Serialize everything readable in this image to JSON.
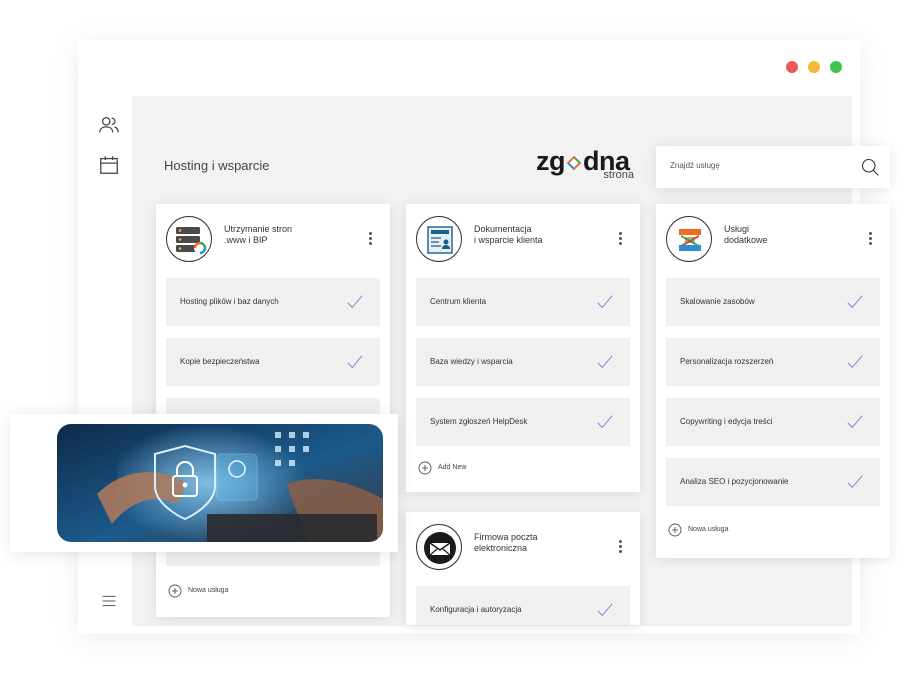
{
  "window": {
    "controls": [
      {
        "name": "close",
        "color": "#ec5b5b"
      },
      {
        "name": "minimize",
        "color": "#f2b83a"
      },
      {
        "name": "maximize",
        "color": "#3ec44c"
      }
    ]
  },
  "sidebar": {
    "items": [
      {
        "icon": "users-icon"
      },
      {
        "icon": "calendar-icon"
      },
      {
        "icon": "menu-icon"
      }
    ]
  },
  "header": {
    "title": "Hosting i wsparcie",
    "logo": {
      "main_left": "zg",
      "main_right": "dna",
      "sub": "strona"
    },
    "search": {
      "placeholder": "Znajdź usługę",
      "icon": "search-icon"
    }
  },
  "cards": [
    {
      "title": "Utrzymanie stron\n.www i BIP",
      "icon": "server-icon",
      "tasks": [
        "Hosting plików i baz danych",
        "Kopie bezpieczeństwa",
        "",
        "",
        ""
      ],
      "add_label": "Nowa usługa"
    },
    {
      "title": "Dokumentacja\ni wsparcie klienta",
      "icon": "document-icon",
      "tasks": [
        "Centrum klienta",
        "Baza wiedzy i wsparcia",
        "System zgłoszeń HelpDesk"
      ],
      "add_label": "Add New"
    },
    {
      "title": "Usługi\ndodatkowe",
      "icon": "extensions-icon",
      "tasks": [
        "Skalowanie zasobów",
        "Personalizacja rozszerzeń",
        "Copywriting i edycja treści",
        "Analiza SEO i pozycjonowanie"
      ],
      "add_label": "Nowa usługa"
    },
    {
      "title": "Firmowa poczta\nelektroniczna",
      "icon": "mail-icon",
      "tasks": [
        "Konfiguracja i autoryzacja"
      ],
      "add_label": ""
    }
  ],
  "colors": {
    "accent_check": "#8a7fd8",
    "logo_orange": "#f26b21",
    "logo_green": "#3caa4a",
    "content_bg": "#f2f2f2",
    "task_bg": "#f0f0f0"
  },
  "photo": {
    "subject": "security-lock-image"
  }
}
